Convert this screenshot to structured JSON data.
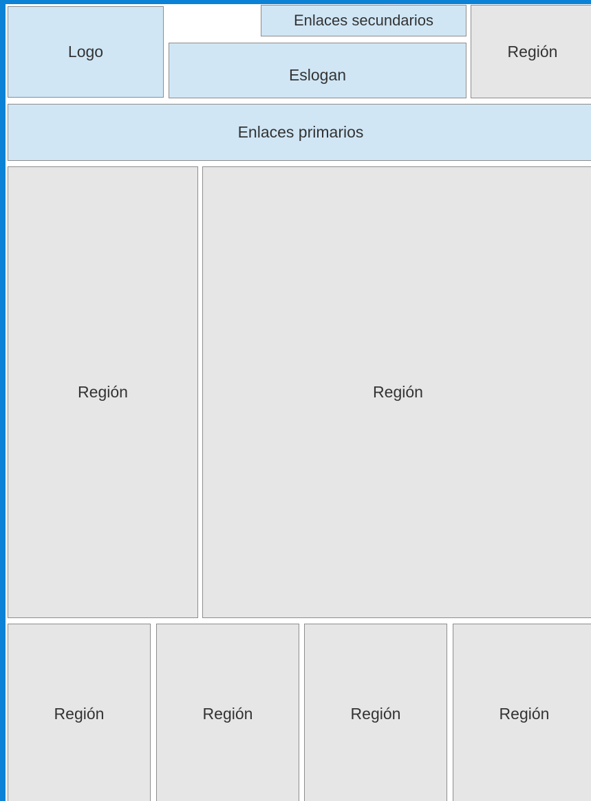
{
  "header": {
    "logo_label": "Logo",
    "secondary_links_label": "Enlaces secundarios",
    "slogan_label": "Eslogan",
    "top_region_label": "Región"
  },
  "navigation": {
    "primary_links_label": "Enlaces primarios"
  },
  "content": {
    "sidebar_region_label": "Región",
    "main_region_label": "Región"
  },
  "footer": {
    "regions": [
      "Región",
      "Región",
      "Región",
      "Región"
    ]
  },
  "colors": {
    "frame_blue": "#0b82d6",
    "fixed_element_fill": "#d0e6f5",
    "region_fill": "#e6e6e6",
    "border": "#8c8c8c"
  }
}
